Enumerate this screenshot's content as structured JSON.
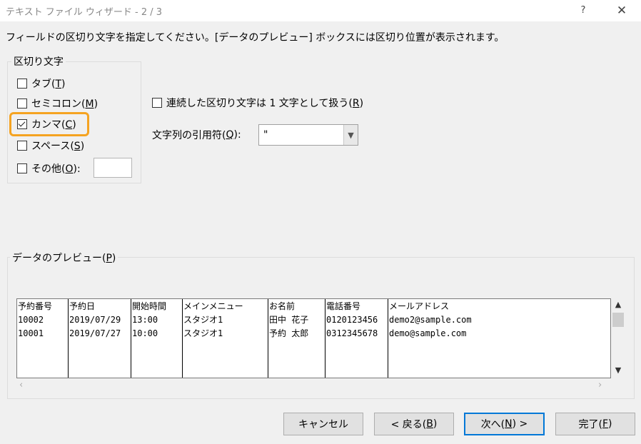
{
  "window": {
    "title": "テキスト ファイル ウィザード - 2 / 3",
    "help_label": "?",
    "close_label": "✕"
  },
  "instruction": "フィールドの区切り文字を指定してください。[データのプレビュー] ボックスには区切り位置が表示されます。",
  "delimiters": {
    "group_label": "区切り文字",
    "items": [
      {
        "label": "タブ(",
        "key": "T",
        "suffix": ")",
        "checked": false
      },
      {
        "label": "セミコロン(",
        "key": "M",
        "suffix": ")",
        "checked": false
      },
      {
        "label": "カンマ(",
        "key": "C",
        "suffix": ")",
        "checked": true
      },
      {
        "label": "スペース(",
        "key": "S",
        "suffix": ")",
        "checked": false
      },
      {
        "label": "その他(",
        "key": "O",
        "suffix": "):",
        "checked": false
      }
    ],
    "other_value": "",
    "highlight_color": "#f5a321"
  },
  "consecutive": {
    "label": "連続した区切り文字は 1 文字として扱う(",
    "key": "R",
    "suffix": ")",
    "checked": false
  },
  "text_qualifier": {
    "label": "文字列の引用符(",
    "key": "Q",
    "suffix": "):",
    "value": "\""
  },
  "preview": {
    "group_label_prefix": "データのプレビュー(",
    "group_label_key": "P",
    "group_label_suffix": ")",
    "columns": [
      {
        "header": "予約番号",
        "cells": [
          "10002",
          "10001"
        ]
      },
      {
        "header": "予約日",
        "cells": [
          "2019/07/29",
          "2019/07/27"
        ]
      },
      {
        "header": "開始時間",
        "cells": [
          "13:00",
          "10:00"
        ]
      },
      {
        "header": "メインメニュー",
        "cells": [
          "スタジオ1",
          "スタジオ1"
        ]
      },
      {
        "header": "お名前",
        "cells": [
          "田中 花子",
          "予約 太郎"
        ]
      },
      {
        "header": "電話番号",
        "cells": [
          "0120123456",
          "0312345678"
        ]
      },
      {
        "header": "メールアドレス",
        "cells": [
          "demo2@sample.com",
          "demo@sample.com"
        ]
      }
    ]
  },
  "buttons": {
    "cancel": "キャンセル",
    "back_prefix": "< 戻る(",
    "back_key": "B",
    "back_suffix": ")",
    "next_prefix": "次へ(",
    "next_key": "N",
    "next_suffix": ") >",
    "finish_prefix": "完了(",
    "finish_key": "F",
    "finish_suffix": ")"
  },
  "colors": {
    "accent": "#0078d7",
    "background": "#f0f0f0"
  }
}
